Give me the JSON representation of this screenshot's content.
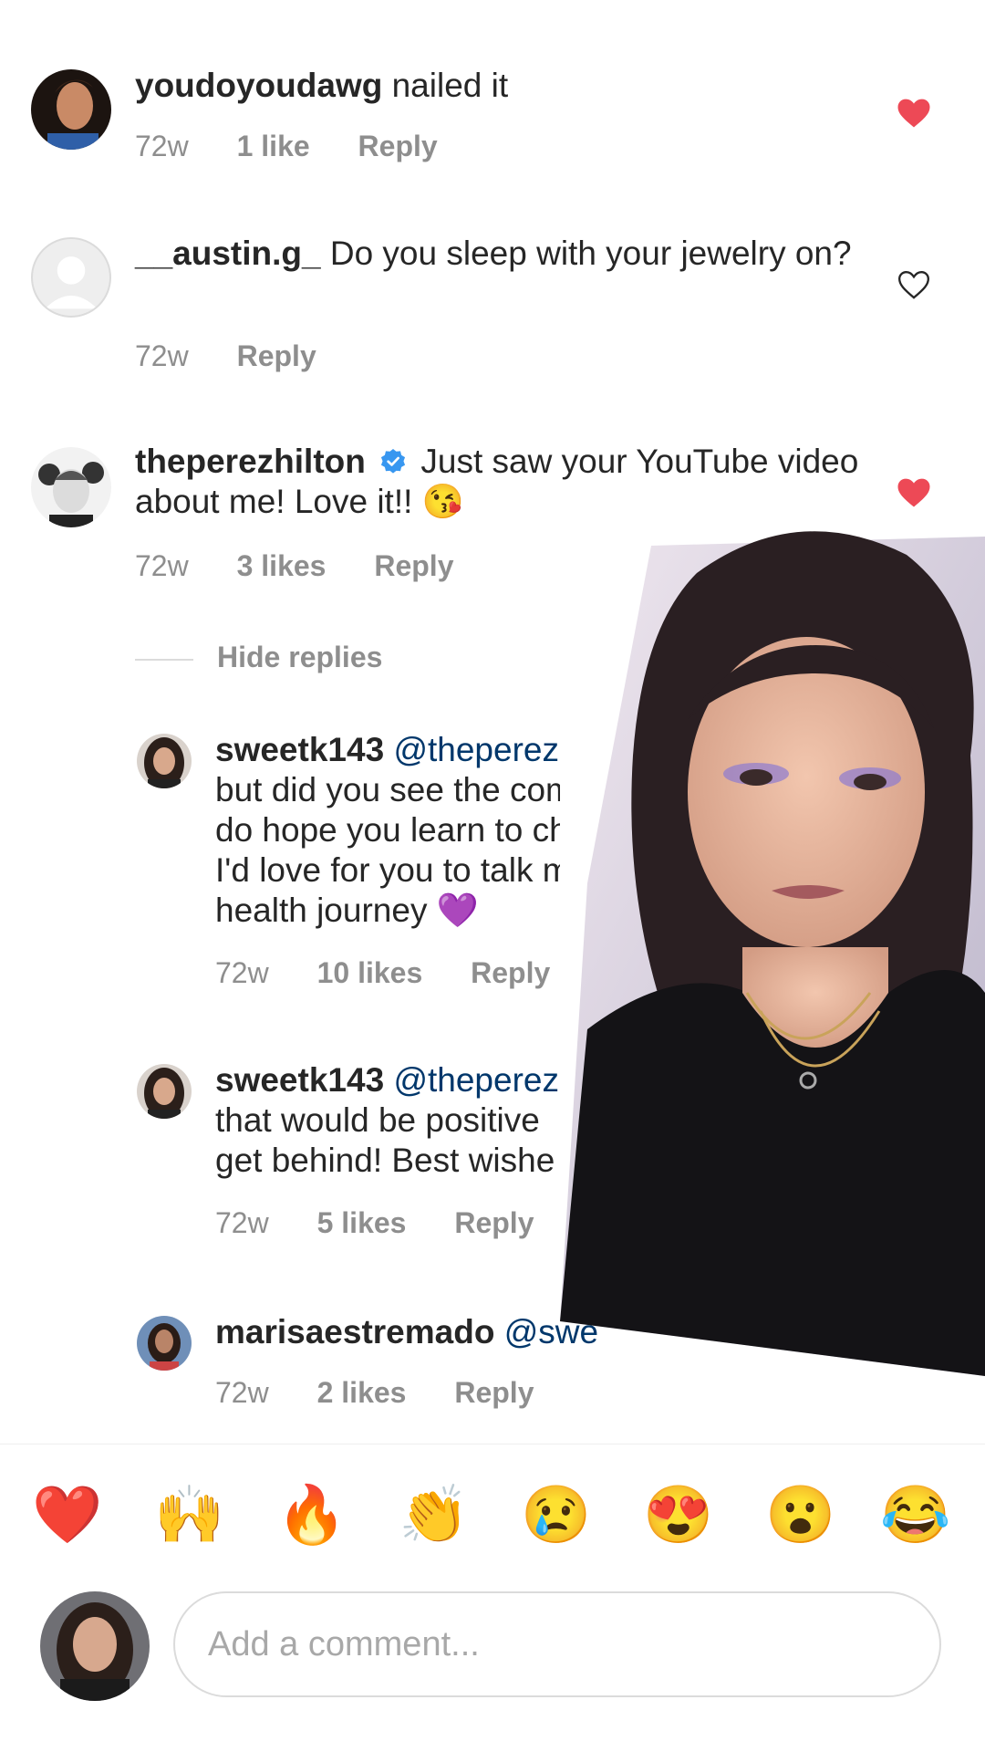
{
  "comments": [
    {
      "user": "youdoyoudawg",
      "text": "nailed it",
      "time": "72w",
      "likes": "1 like",
      "reply": "Reply",
      "liked": true
    },
    {
      "user": "__austin.g_",
      "text": "Do you sleep with your jewelry on?",
      "time": "72w",
      "reply": "Reply",
      "liked": false
    },
    {
      "user": "theperezhilton",
      "verified": true,
      "text": "Just saw your YouTube video about me! Love it!! 😘",
      "time": "72w",
      "likes": "3 likes",
      "reply": "Reply",
      "liked": true
    }
  ],
  "hide_replies": "Hide replies",
  "replies": [
    {
      "user": "sweetk143",
      "mention": "@theperezhilton",
      "lines": [
        "but did you see the comment",
        "do hope you learn to change",
        "I'd love for you to talk more",
        "health journey 💜"
      ],
      "time": "72w",
      "likes": "10 likes",
      "reply": "Reply"
    },
    {
      "user": "sweetk143",
      "mention": "@theperez",
      "lines": [
        "that would be positive",
        "get behind! Best wishe"
      ],
      "time": "72w",
      "likes": "5 likes",
      "reply": "Reply"
    },
    {
      "user": "marisaestremado",
      "mention": "@swe",
      "time": "72w",
      "likes": "2 likes",
      "reply": "Reply"
    }
  ],
  "emoji_bar": [
    "❤️",
    "🙌",
    "🔥",
    "👏",
    "😢",
    "😍",
    "😮",
    "😂"
  ],
  "comment_input": {
    "placeholder": "Add a comment..."
  },
  "colors": {
    "heart": "#ed4956",
    "mention": "#00376b",
    "meta": "#8e8e8e",
    "verified": "#3897f0"
  }
}
